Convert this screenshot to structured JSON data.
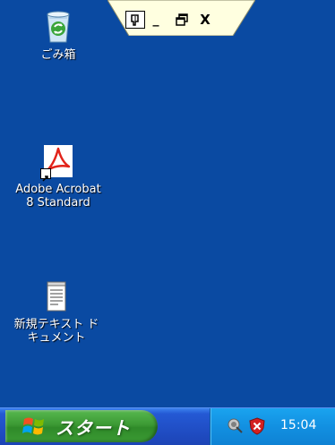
{
  "connection_bar": {
    "pin_icon": "pin-icon",
    "minimize_label": "_",
    "restore_icon": "restore-icon",
    "close_label": "X"
  },
  "desktop": {
    "icons": [
      {
        "label": "ごみ箱",
        "icon": "recycle-bin-icon"
      },
      {
        "label": "Adobe Acrobat\n8 Standard",
        "icon": "acrobat-icon"
      },
      {
        "label": "新規テキスト ド\nキュメント",
        "icon": "notepad-text-document-icon"
      }
    ]
  },
  "taskbar": {
    "start_label": "スタート",
    "start_icon": "windows-logo-icon",
    "tray": {
      "icons": [
        "network-icon",
        "security-shield-icon"
      ],
      "clock": "15:04"
    }
  },
  "colors": {
    "desktop_background": "#0a4aa2",
    "taskbar_blue": "#2150c8",
    "start_green": "#3c9a34",
    "tray_blue": "#1290e1"
  }
}
